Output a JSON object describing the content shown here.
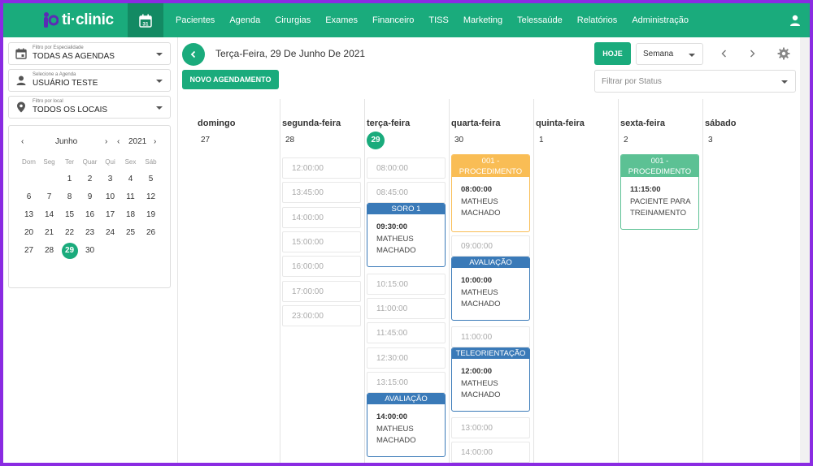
{
  "topbar": {
    "logo_text": "ti·clinic",
    "calendar_day": "31",
    "nav": [
      "Pacientes",
      "Agenda",
      "Cirurgias",
      "Exames",
      "Financeiro",
      "TISS",
      "Marketing",
      "Telessaúde",
      "Relatórios",
      "Administração"
    ]
  },
  "sidebar": {
    "filter_especialidade": {
      "label": "Filtro por Especialidade",
      "value": "TODAS AS AGENDAS"
    },
    "filter_agenda": {
      "label": "Selecione a Agenda",
      "value": "USUÁRIO TESTE"
    },
    "filter_local": {
      "label": "Filtro por local",
      "value": "TODOS OS LOCAIS"
    },
    "mini_calendar": {
      "month": "Junho",
      "year": "2021",
      "weekdays": [
        "Dom",
        "Seg",
        "Ter",
        "Quar",
        "Qui",
        "Sex",
        "Sáb"
      ],
      "weeks": [
        [
          "",
          "",
          "1",
          "2",
          "3",
          "4",
          "5"
        ],
        [
          "6",
          "7",
          "8",
          "9",
          "10",
          "11",
          "12"
        ],
        [
          "13",
          "14",
          "15",
          "16",
          "17",
          "18",
          "19"
        ],
        [
          "20",
          "21",
          "22",
          "23",
          "24",
          "25",
          "26"
        ],
        [
          "27",
          "28",
          "29",
          "30",
          "",
          "",
          ""
        ]
      ],
      "selected": "29"
    }
  },
  "header": {
    "date_title": "Terça-Feira, 29 De Junho De 2021",
    "new_button": "NOVO AGENDAMENTO",
    "today_button": "HOJE",
    "view_value": "Semana",
    "status_placeholder": "Filtrar por Status"
  },
  "colors": {
    "brand": "#1aab7c",
    "orange": "#f9bd55",
    "blue": "#3a7ab8",
    "green_light": "#5cc194"
  },
  "days": [
    {
      "name": "domingo",
      "num": "27"
    },
    {
      "name": "segunda-feira",
      "num": "28"
    },
    {
      "name": "terça-feira",
      "num": "29"
    },
    {
      "name": "quarta-feira",
      "num": "30"
    },
    {
      "name": "quinta-feira",
      "num": "1"
    },
    {
      "name": "sexta-feira",
      "num": "2"
    },
    {
      "name": "sábado",
      "num": "3"
    }
  ],
  "slots": {
    "segunda": [
      "12:00:00",
      "13:45:00",
      "14:00:00",
      "15:00:00",
      "16:00:00",
      "17:00:00",
      "23:00:00"
    ],
    "terca": [
      "08:00:00",
      "08:45:00",
      "10:15:00",
      "11:00:00",
      "11:45:00",
      "12:30:00",
      "13:15:00"
    ],
    "quarta": [
      "09:00:00",
      "11:00:00",
      "13:00:00",
      "14:00:00"
    ]
  },
  "appointments": {
    "terca_1": {
      "type": "SORO 1",
      "time": "09:30:00",
      "patient": "MATHEUS MACHADO"
    },
    "terca_2": {
      "type": "AVALIAÇÃO",
      "time": "14:00:00",
      "patient": "MATHEUS MACHADO"
    },
    "quarta_1": {
      "type": "001 - PROCEDIMENTO",
      "time": "08:00:00",
      "patient": "MATHEUS MACHADO"
    },
    "quarta_2": {
      "type": "AVALIAÇÃO",
      "time": "10:00:00",
      "patient": "MATHEUS MACHADO"
    },
    "quarta_3": {
      "type": "TELEORIENTAÇÃO",
      "time": "12:00:00",
      "patient": "MATHEUS MACHADO"
    },
    "sexta_1": {
      "type": "001 - PROCEDIMENTO",
      "time": "11:15:00",
      "patient": "PACIENTE PARA TREINAMENTO"
    }
  }
}
